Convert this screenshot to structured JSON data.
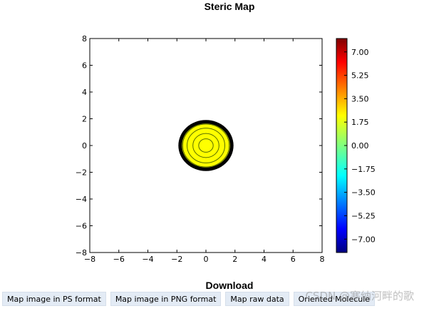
{
  "chart_data": {
    "type": "heatmap",
    "title": "Steric Map",
    "xlabel": "",
    "ylabel": "",
    "xlim": [
      -8,
      8
    ],
    "ylim": [
      -8,
      8
    ],
    "x_ticks": [
      "−8",
      "−6",
      "−4",
      "−2",
      "0",
      "2",
      "4",
      "6",
      "8"
    ],
    "y_ticks": [
      "8",
      "6",
      "4",
      "2",
      "0",
      "−2",
      "−4",
      "−6",
      "−8"
    ],
    "grid": false,
    "colormap": "jet",
    "colorbar": {
      "range": [
        -8,
        8
      ],
      "ticks": [
        "7.00",
        "5.25",
        "3.50",
        "1.75",
        "0.00",
        "−1.75",
        "−3.50",
        "−5.25",
        "−7.00"
      ],
      "tick_values": [
        7.0,
        5.25,
        3.5,
        1.75,
        0.0,
        -1.75,
        -3.5,
        -5.25,
        -7.0
      ]
    },
    "feature": {
      "shape": "filled contour blob",
      "center": [
        0,
        0
      ],
      "radius": 1.8,
      "fill_color": "#ffff00",
      "contour_radii": [
        0.5,
        0.9,
        1.3,
        1.6
      ],
      "edge_color": "#000000"
    }
  },
  "download": {
    "title": "Download",
    "buttons": [
      {
        "label": "Map image in PS format"
      },
      {
        "label": "Map image in PNG format"
      },
      {
        "label": "Map raw data"
      },
      {
        "label": "Oriented Molecule"
      }
    ]
  },
  "watermark": "CSDN @寒纳河畔的歌"
}
